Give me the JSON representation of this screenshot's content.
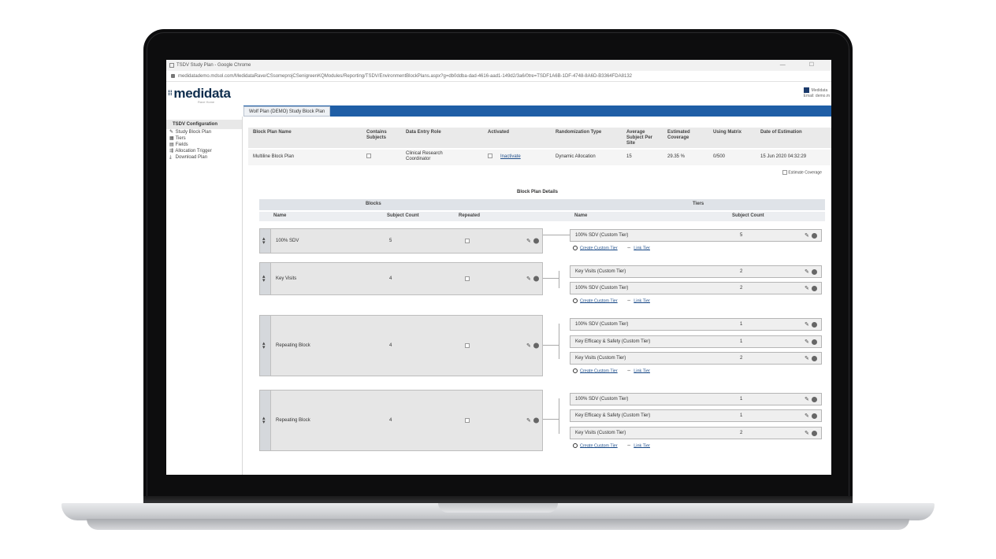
{
  "browser": {
    "title": "TSDV Study Plan - Google Chrome",
    "url": "medidatademo.mdsol.com/MedidataRave/CSsomeprojCSenigreenKQModules/Reporting/TSDV/EnvironmentBlockPlans.aspx?g=db0ddba-dad-4616-aad1-149d2/3a6/0tre=TSDF1A6B-1DF-4748-8A6D-B3364FDA8132",
    "window_controls": "— ☐"
  },
  "app": {
    "logo": "medidata",
    "logo_sub": "Rave Home",
    "user_line1": "Medidata",
    "user_line2": "Email: demo.m",
    "tab_label": "Wolf Plan (DEMO) Study Block Plan"
  },
  "nav": {
    "header": "TSDV Configuration",
    "items": [
      {
        "icon": "✎",
        "label": "Study Block Plan"
      },
      {
        "icon": "▦",
        "label": "Tiers"
      },
      {
        "icon": "▤",
        "label": "Fields"
      },
      {
        "icon": "⇶",
        "label": "Allocation Trigger"
      },
      {
        "icon": "⤓",
        "label": "Download Plan"
      }
    ]
  },
  "summary": {
    "headers": {
      "name": "Block Plan Name",
      "contains": "Contains Subjects",
      "role": "Data Entry Role",
      "activated": "Activated",
      "rand": "Randomization Type",
      "avg": "Average Subject Per Site",
      "est": "Estimated Coverage",
      "matrix": "Using Matrix",
      "date": "Date of Estimation"
    },
    "row": {
      "name": "Multiline Block Plan",
      "role": "Clinical Research Coordinator",
      "activated": "Inactivate",
      "rand": "Dynamic Allocation",
      "avg": "15",
      "est": "29.35 %",
      "matrix": "0/500",
      "date": "15 Jun 2020 04:32:29"
    },
    "estimate_label": "Estimate Coverage"
  },
  "details": {
    "title": "Block Plan Details",
    "blocks_header": "Blocks",
    "tiers_header": "Tiers",
    "col_name": "Name",
    "col_subject_count": "Subject Count",
    "col_repeated": "Repeated",
    "col_tier_name": "Name",
    "col_tier_count": "Subject Count",
    "create_tier": "Create Custom Tier",
    "link_tier": "Link Tier",
    "blocks": [
      {
        "name": "100% SDV",
        "count": "5",
        "tiers": [
          {
            "name": "100% SDV (Custom Tier)",
            "count": "5"
          }
        ]
      },
      {
        "name": "Key Visits",
        "count": "4",
        "tiers": [
          {
            "name": "Key Visits (Custom Tier)",
            "count": "2"
          },
          {
            "name": "100% SDV (Custom Tier)",
            "count": "2"
          }
        ]
      },
      {
        "name": "Repeating Block",
        "count": "4",
        "tiers": [
          {
            "name": "100% SDV (Custom Tier)",
            "count": "1"
          },
          {
            "name": "Key Efficacy & Safety (Custom Tier)",
            "count": "1"
          },
          {
            "name": "Key Visits (Custom Tier)",
            "count": "2"
          }
        ]
      },
      {
        "name": "Repeating Block",
        "count": "4",
        "tiers": [
          {
            "name": "100% SDV (Custom Tier)",
            "count": "1"
          },
          {
            "name": "Key Efficacy & Safety (Custom Tier)",
            "count": "1"
          },
          {
            "name": "Key Visits (Custom Tier)",
            "count": "2"
          }
        ]
      }
    ]
  }
}
